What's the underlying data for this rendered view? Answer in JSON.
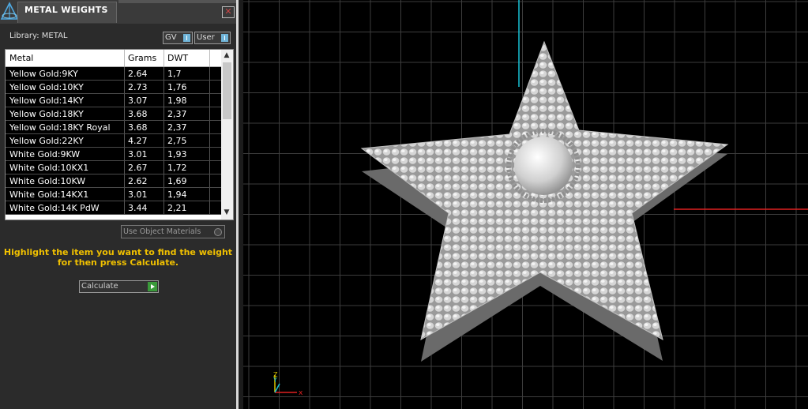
{
  "window": {
    "title": "METAL WEIGHTS",
    "close_icon": "close-icon"
  },
  "library": {
    "label": "Library: METAL"
  },
  "toggles": {
    "gv": "GV",
    "user": "User"
  },
  "table": {
    "headers": [
      "Metal",
      "Grams",
      "DWT"
    ],
    "rows": [
      [
        "Yellow Gold:9KY",
        "2.64",
        "1,7"
      ],
      [
        "Yellow Gold:10KY",
        "2.73",
        "1,76"
      ],
      [
        "Yellow Gold:14KY",
        "3.07",
        "1,98"
      ],
      [
        "Yellow Gold:18KY",
        "3.68",
        "2,37"
      ],
      [
        "Yellow Gold:18KY Royal",
        "3.68",
        "2,37"
      ],
      [
        "Yellow Gold:22KY",
        "4.27",
        "2,75"
      ],
      [
        "White Gold:9KW",
        "3.01",
        "1,93"
      ],
      [
        "White Gold:10KX1",
        "2.67",
        "1,72"
      ],
      [
        "White Gold:10KW",
        "2.62",
        "1,69"
      ],
      [
        "White Gold:14KX1",
        "3.01",
        "1,94"
      ],
      [
        "White Gold:14K PdW",
        "3.44",
        "2,21"
      ]
    ]
  },
  "use_object_materials": "Use Object Materials",
  "hint": {
    "line1": "Highlight the item you want to find the weight",
    "line2": "for then press Calculate."
  },
  "calculate": {
    "label": "Calculate"
  },
  "viewport": {
    "axis_labels": {
      "z": "Z",
      "y": "Y",
      "x": "x"
    },
    "colors": {
      "grid": "#3d3d3d",
      "x_axis": "#e02020",
      "y_axis": "#19c2d6",
      "star": "#d8d8d8"
    }
  }
}
